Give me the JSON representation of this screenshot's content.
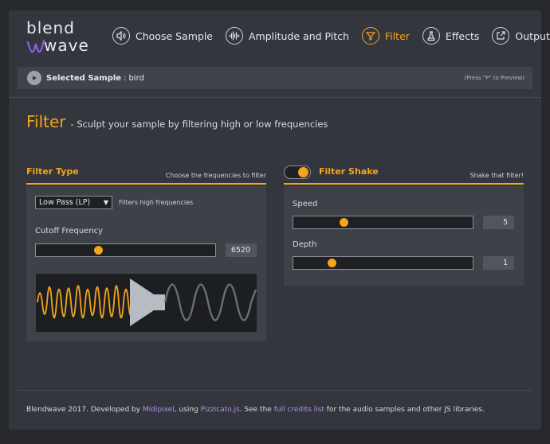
{
  "logo": {
    "line1": "blend",
    "line2": "wave"
  },
  "nav": {
    "items": [
      {
        "label": "Choose Sample",
        "icon": "speaker-icon"
      },
      {
        "label": "Amplitude and Pitch",
        "icon": "waveform-icon"
      },
      {
        "label": "Filter",
        "icon": "filter-icon",
        "active": true
      },
      {
        "label": "Effects",
        "icon": "flask-icon"
      },
      {
        "label": "Output",
        "icon": "export-icon"
      }
    ]
  },
  "sample_bar": {
    "title": "Selected Sample",
    "separator": ":",
    "name": "bird",
    "hint": "(Press \"P\" to Preview)"
  },
  "page": {
    "title": "Filter",
    "subtitle": "- Sculpt your sample by filtering high or low frequencies"
  },
  "filter_type": {
    "title": "Filter Type",
    "right_text": "Choose the frequencies to filter",
    "select_value": "Low Pass (LP)",
    "select_note": "Filters high frequencies",
    "cutoff_label": "Cutoff Frequency",
    "cutoff_value": "6520",
    "cutoff_fraction": 0.34
  },
  "filter_shake": {
    "title": "Filter Shake",
    "right_text": "Shake that filter!",
    "enabled": true,
    "speed_label": "Speed",
    "speed_value": "5",
    "speed_fraction": 0.27,
    "depth_label": "Depth",
    "depth_value": "1",
    "depth_fraction": 0.2
  },
  "footer": {
    "t1": "Blendwave 2017. Developed by ",
    "link1": "Midipixel",
    "t2": ", using ",
    "link2": "Pizzicato.js",
    "t3": ". See the ",
    "link3": "full credits list",
    "t4": " for the audio samples and other JS libraries."
  },
  "colors": {
    "accent": "#f3a51b",
    "link": "#b08ee6",
    "background": "#26282c",
    "panel": "#33363c"
  }
}
